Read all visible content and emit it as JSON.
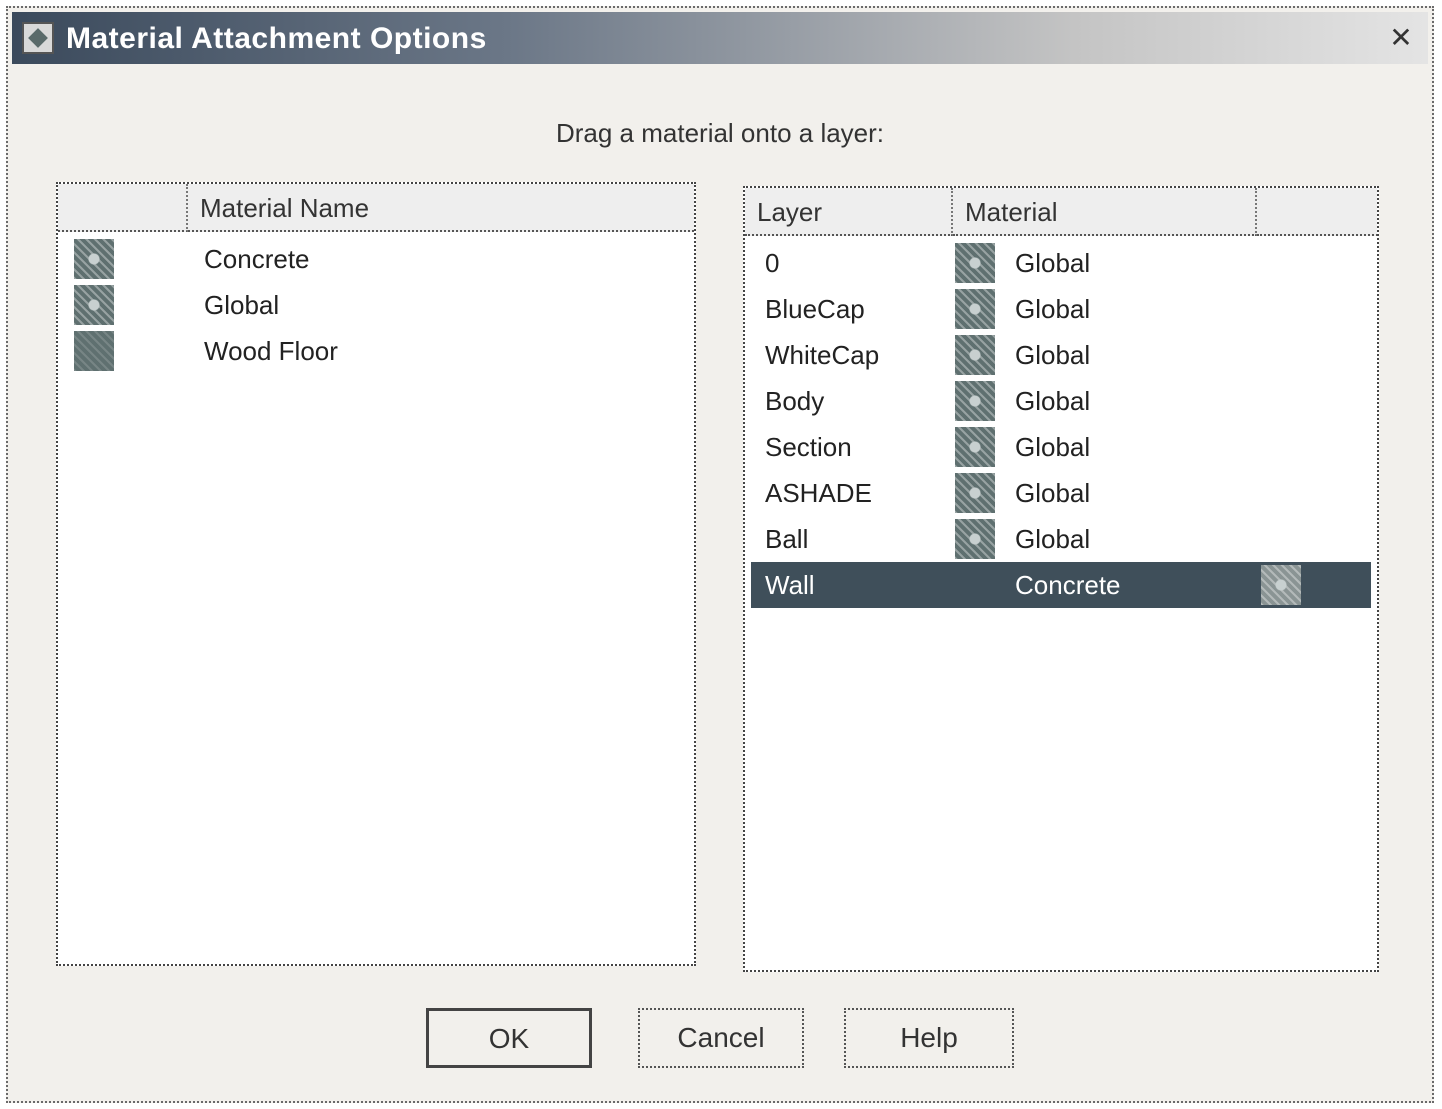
{
  "window": {
    "title": "Material Attachment Options",
    "close_glyph": "✕"
  },
  "instruction": "Drag a material onto a layer:",
  "materials_list": {
    "header": "Material Name",
    "items": [
      {
        "name": "Concrete",
        "icon": "material-swatch-icon"
      },
      {
        "name": "Global",
        "icon": "material-swatch-icon"
      },
      {
        "name": "Wood Floor",
        "icon": "material-swatch-icon"
      }
    ]
  },
  "layers_list": {
    "headers": {
      "layer": "Layer",
      "material": "Material",
      "extra": ""
    },
    "rows": [
      {
        "layer": "0",
        "material": "Global"
      },
      {
        "layer": "BlueCap",
        "material": "Global"
      },
      {
        "layer": "WhiteCap",
        "material": "Global"
      },
      {
        "layer": "Body",
        "material": "Global"
      },
      {
        "layer": "Section",
        "material": "Global"
      },
      {
        "layer": "ASHADE",
        "material": "Global"
      },
      {
        "layer": "Ball",
        "material": "Global"
      },
      {
        "layer": "Wall",
        "material": "Concrete",
        "selected": true
      }
    ]
  },
  "buttons": {
    "ok": "OK",
    "cancel": "Cancel",
    "help": "Help"
  },
  "colors": {
    "selection": "#3f4f5a",
    "swatch": "#5f7070"
  }
}
